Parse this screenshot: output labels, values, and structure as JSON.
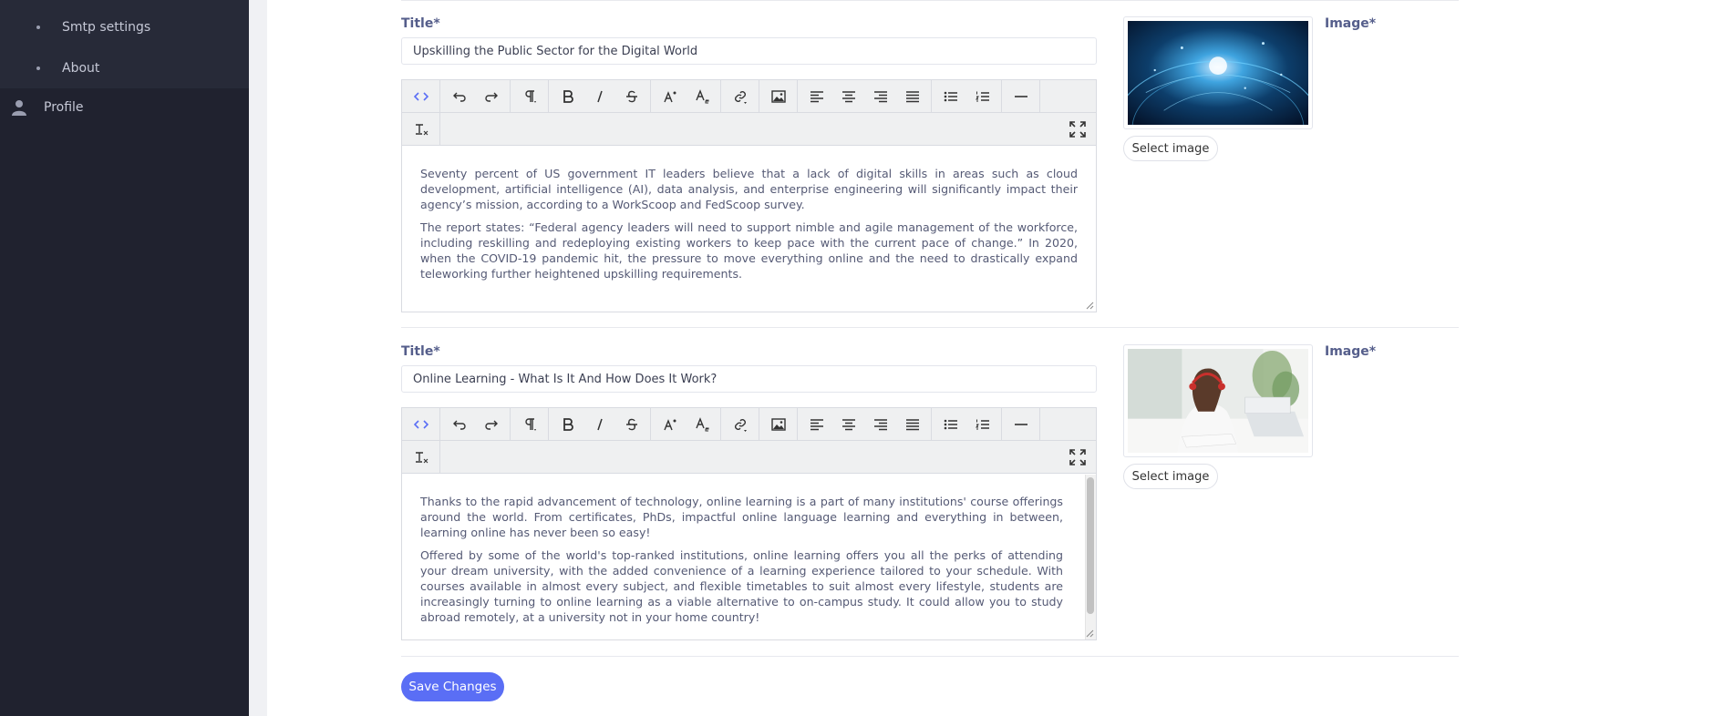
{
  "sidebar": {
    "sub_items": [
      {
        "label": "Smtp settings"
      },
      {
        "label": "About"
      }
    ],
    "profile_label": "Profile"
  },
  "sections": [
    {
      "title_label": "Title*",
      "title_value": "Upskilling the Public Sector for the Digital World",
      "paragraphs": [
        "Seventy percent of US government IT leaders believe that a lack of digital skills in areas such as cloud development, artificial intelligence (AI), data analysis, and enterprise engineering will significantly impact their agency’s mission, according to a WorkScoop and FedScoop survey.",
        "The report states: “Federal agency leaders will need to support nimble and agile management of the workforce, including reskilling and redeploying existing workers to keep pace with the current pace of change.” In 2020, when the COVID-19 pandemic hit, the pressure to move everything online and the need to drastically expand teleworking further heightened upskilling requirements."
      ],
      "image_label": "Image*",
      "select_label": "Select image"
    },
    {
      "title_label": "Title*",
      "title_value": "Online Learning - What Is It And How Does It Work?",
      "paragraphs": [
        "Thanks to the rapid advancement of technology, online learning is a part of many institutions' course offerings around the world. From certificates, PhDs, impactful online language learning and everything in between, learning online has never been so easy!",
        "Offered by some of the world's top-ranked institutions, online learning offers you all the perks of attending your dream university, with the added convenience of a learning experience tailored to your schedule. With courses available in almost every subject, and flexible timetables to suit almost every lifestyle, students are increasingly turning to online learning as a viable alternative to on-campus study. It could allow you to study abroad remotely, at a university not in your home country!"
      ],
      "image_label": "Image*",
      "select_label": "Select image"
    }
  ],
  "save_label": "Save Changes",
  "colors": {
    "sidebar_bg": "#20222f",
    "accent": "#5a6ef5",
    "label": "#555e8b"
  }
}
